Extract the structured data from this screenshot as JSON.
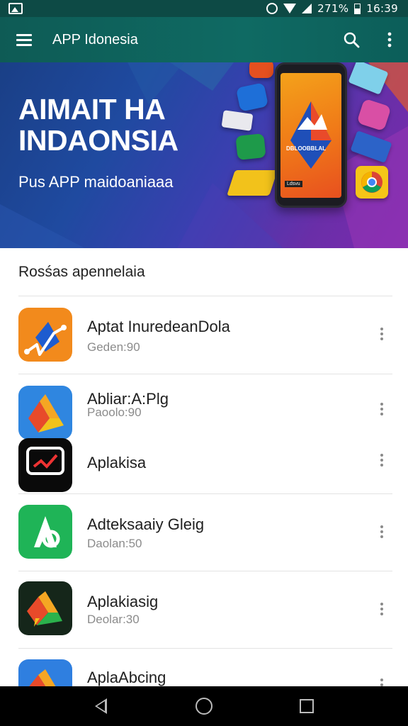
{
  "status_bar": {
    "battery_text": "271%",
    "time": "16:39"
  },
  "app_bar": {
    "title": "APP Idonesia"
  },
  "banner": {
    "headline_line1": "AIMAIT HA",
    "headline_line2": "INDAONSIA",
    "subtitle": "Pus APP maidoaniaaa",
    "phone_label": "DBLOOBBLAL",
    "phone_caption": "Ldsvu"
  },
  "section": {
    "title": "Rosśas apennelaia"
  },
  "apps": [
    {
      "name": "Aptat InuredeanDola",
      "meta": "Geden:90",
      "icon": "orange-map-pin-icon"
    },
    {
      "name": "Abliar:A:Plg",
      "meta": "Paoolo:90",
      "icon": "drive-triangle-icon"
    },
    {
      "name": "Aplakisa",
      "meta": "",
      "icon": "black-chart-icon"
    },
    {
      "name": "Adteksaaiy Gleig",
      "meta": "Daolan:50",
      "icon": "green-a-icon"
    },
    {
      "name": "Aplakiasig",
      "meta": "Deolar:30",
      "icon": "dark-drive-icon"
    },
    {
      "name": "AplaAbcing",
      "meta": "",
      "icon": "blue-drive-icon"
    }
  ],
  "colors": {
    "app_bar": "#0f6a63",
    "status_bar": "#0d4a45",
    "banner_start": "#1a3f86",
    "banner_end": "#7d2ab0"
  }
}
